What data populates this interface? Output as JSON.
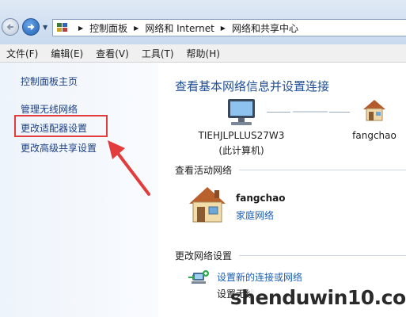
{
  "address_bar": {
    "breadcrumbs": [
      "控制面板",
      "网络和 Internet",
      "网络和共享中心"
    ]
  },
  "menu": {
    "items": [
      "文件(F)",
      "编辑(E)",
      "查看(V)",
      "工具(T)",
      "帮助(H)"
    ]
  },
  "left_pane": {
    "home_link": "控制面板主页",
    "links": [
      "管理无线网络",
      "更改适配器设置",
      "更改高级共享设置"
    ],
    "highlighted_link": "更改适配器设置",
    "highlight_color": "#e23c3c"
  },
  "main": {
    "title": "查看基本网络信息并设置连接",
    "network_map": {
      "computer_name": "TIEHJLPLLUS27W3",
      "computer_caption": "(此计算机)",
      "network_name": "fangchao"
    },
    "active_networks": {
      "header": "查看活动网络",
      "network": {
        "name": "fangchao",
        "type": "家庭网络"
      }
    },
    "change_settings": {
      "header": "更改网络设置",
      "tasks": [
        {
          "link": "设置新的连接或网络",
          "description": "设置无线"
        }
      ]
    }
  },
  "watermark": "shenduwin10.com",
  "colors": {
    "link": "#1c3f86",
    "title": "#1f4e96",
    "accent_link": "#1c5fb8"
  }
}
